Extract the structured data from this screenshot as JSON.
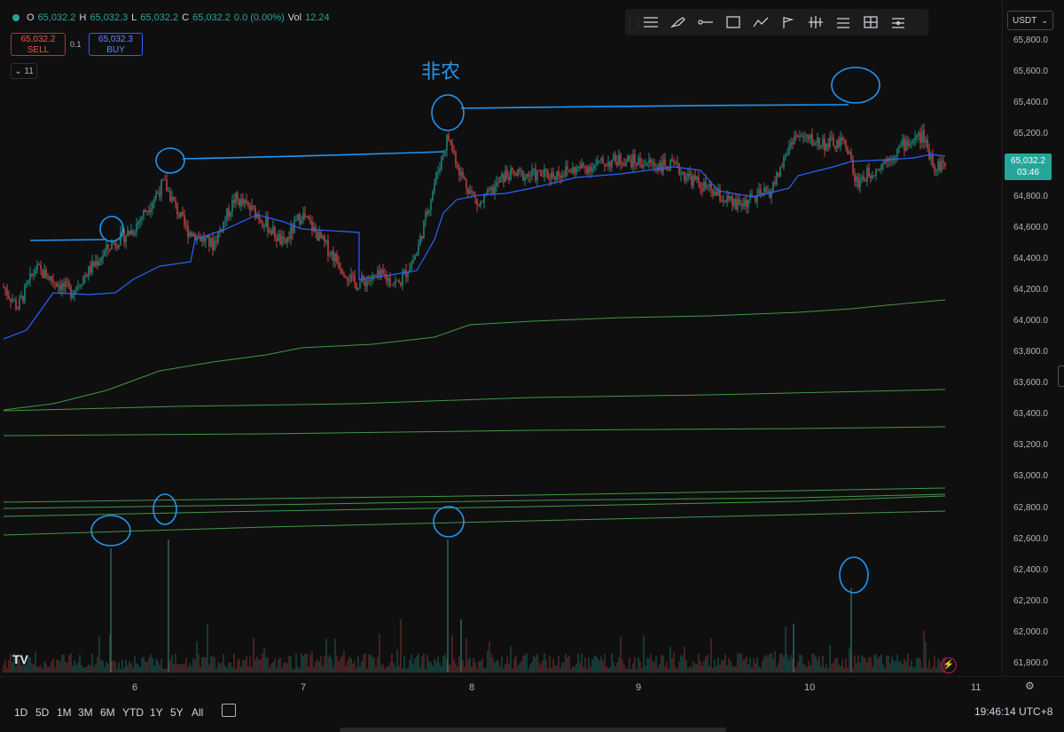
{
  "legend": {
    "open_label": "O",
    "open": "65,032.2",
    "high_label": "H",
    "high": "65,032.3",
    "low_label": "L",
    "low": "65,032.2",
    "close_label": "C",
    "close": "65,032.2",
    "change": "0.0 (0.00%)",
    "vol_label": "Vol",
    "vol": "12.24"
  },
  "trade": {
    "sell_price": "65,032.2",
    "sell_label": "SELL",
    "spread": "0.1",
    "buy_price": "65,032.3",
    "buy_label": "BUY"
  },
  "indicators_collapse": "11",
  "toolbar_icons": [
    "horizontal-lines-icon",
    "brush-icon",
    "ray-icon",
    "rectangle-icon",
    "path-icon",
    "flag-icon",
    "pattern-icon",
    "align-icon",
    "measure-icon",
    "settings-list-icon"
  ],
  "currency": "USDT",
  "price_ticks": [
    "65,800.0",
    "65,600.0",
    "65,400.0",
    "65,200.0",
    "65,000.0",
    "64,800.0",
    "64,600.0",
    "64,400.0",
    "64,200.0",
    "64,000.0",
    "63,800.0",
    "63,600.0",
    "63,400.0",
    "63,200.0",
    "63,000.0",
    "62,800.0",
    "62,600.0",
    "62,400.0",
    "62,200.0",
    "62,000.0",
    "61,800.0"
  ],
  "last_price": {
    "price": "65,032.2",
    "countdown": "03:46"
  },
  "dates": [
    "6",
    "7",
    "8",
    "9",
    "10",
    "11"
  ],
  "ranges": [
    "1D",
    "5D",
    "1M",
    "3M",
    "6M",
    "YTD",
    "1Y",
    "5Y",
    "All"
  ],
  "clock": "19:46:14 UTC+8",
  "annotation_text": "非农",
  "logo_text": "TV",
  "colors": {
    "up": "#26a69a",
    "down": "#ef5350",
    "vwap": "#2962ff",
    "ma": "#4caf50",
    "annotation": "#2196f3"
  }
}
